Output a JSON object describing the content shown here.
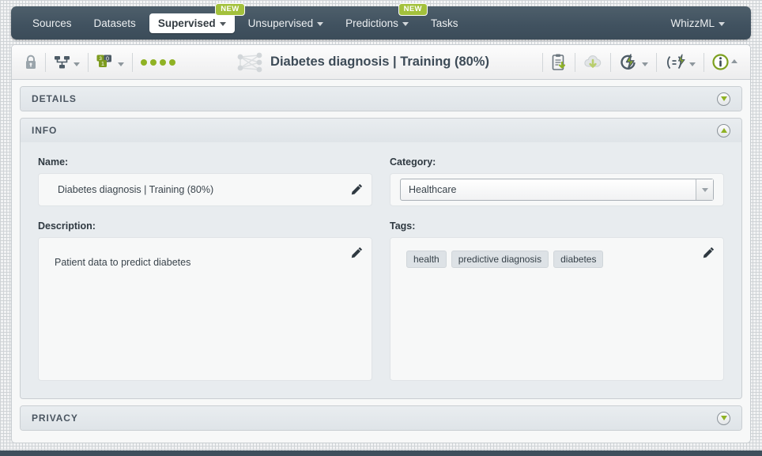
{
  "navbar": {
    "items": [
      {
        "label": "Sources",
        "dropdown": false,
        "active": false,
        "badge": null
      },
      {
        "label": "Datasets",
        "dropdown": false,
        "active": false,
        "badge": null
      },
      {
        "label": "Supervised",
        "dropdown": true,
        "active": true,
        "badge": "NEW"
      },
      {
        "label": "Unsupervised",
        "dropdown": true,
        "active": false,
        "badge": null
      },
      {
        "label": "Predictions",
        "dropdown": true,
        "active": false,
        "badge": "NEW"
      },
      {
        "label": "Tasks",
        "dropdown": false,
        "active": false,
        "badge": null
      }
    ],
    "account": {
      "label": "WhizzML",
      "dropdown": true
    }
  },
  "toolbar": {
    "lock_icon": "lock-icon",
    "source_icon": "sitemap-icon",
    "counts_icon": "resource-counts-icon",
    "counts": {
      "top_left": "3",
      "top_right": "0",
      "bottom": "1"
    },
    "status_dots": 4,
    "resource_icon": "deepnet-icon",
    "title": "Diabetes diagnosis | Training (80%)",
    "actions": [
      {
        "name": "clipboard-download-icon",
        "dropdown": false
      },
      {
        "name": "cloud-download-icon",
        "dropdown": false
      },
      {
        "name": "batch-prediction-icon",
        "dropdown": true
      },
      {
        "name": "evaluation-icon",
        "dropdown": true
      },
      {
        "name": "info-icon",
        "dropdown": true
      }
    ]
  },
  "sections": {
    "details": {
      "title": "DETAILS",
      "expanded": false
    },
    "info": {
      "title": "INFO",
      "expanded": true
    },
    "privacy": {
      "title": "PRIVACY",
      "expanded": false
    }
  },
  "info": {
    "name": {
      "label": "Name:",
      "value": "Diabetes diagnosis | Training (80%)",
      "edit_icon": "pencil-icon"
    },
    "category": {
      "label": "Category:",
      "value": "Healthcare",
      "dropdown_icon": "chevron-down-icon"
    },
    "description": {
      "label": "Description:",
      "value": "Patient data to predict diabetes",
      "edit_icon": "pencil-icon"
    },
    "tags": {
      "label": "Tags:",
      "values": [
        "health",
        "predictive diagnosis",
        "diabetes"
      ],
      "edit_icon": "pencil-icon"
    }
  },
  "colors": {
    "nav_bg": "#415260",
    "accent_green": "#8fb224",
    "badge_green": "#a3c13c",
    "panel_bg": "#e8ecef",
    "field_bg": "#f7f8f8",
    "text_dark": "#3d4b57"
  }
}
